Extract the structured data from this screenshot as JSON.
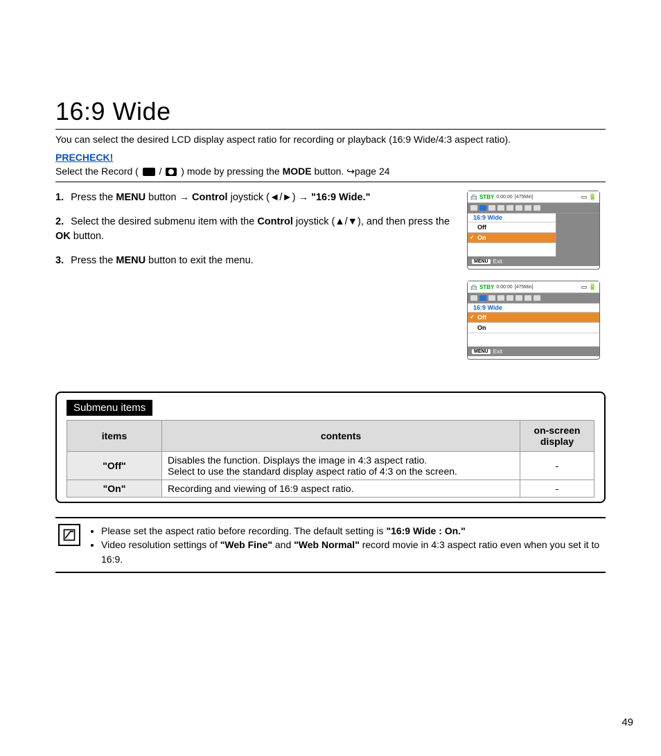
{
  "title": "16:9 Wide",
  "intro": "You can select the desired LCD display aspect ratio for recording or playback (16:9 Wide/4:3 aspect ratio).",
  "precheck": {
    "label": "PRECHECK!",
    "text_before": "Select the Record (",
    "sep": " / ",
    "text_after_icons": ") mode by pressing the ",
    "mode": "MODE",
    "text_after": " button. ",
    "page_ref": "page 24"
  },
  "steps": [
    {
      "num": "1.",
      "parts": [
        "Press the ",
        "MENU",
        " button → ",
        "Control",
        " joystick (◄/►) → ",
        "\"16:9 Wide.\""
      ]
    },
    {
      "num": "2.",
      "parts": [
        "Select the desired submenu item with the ",
        "Control",
        " joystick (▲/▼), and then press the ",
        "OK",
        " button."
      ]
    },
    {
      "num": "3.",
      "parts": [
        "Press the ",
        "MENU",
        " button to exit the menu."
      ]
    }
  ],
  "osd": {
    "stby": "STBY",
    "time": "0:00:00",
    "min": "[475Min]",
    "menu_title": "16:9 Wide",
    "off": "Off",
    "on": "On",
    "menu": "MENU",
    "exit": "Exit"
  },
  "submenu": {
    "label": "Submenu items",
    "headers": [
      "items",
      "contents",
      "on-screen display"
    ],
    "rows": [
      {
        "item": "\"Off\"",
        "content": "Disables the function. Displays the image in 4:3 aspect ratio.\nSelect to use the standard display aspect ratio of 4:3 on the screen.",
        "osd": "-"
      },
      {
        "item": "\"On\"",
        "content": "Recording and viewing of 16:9 aspect ratio.",
        "osd": "-"
      }
    ]
  },
  "notes": {
    "bullets": [
      {
        "pre": "Please set the aspect ratio before recording. The default setting is ",
        "b": "\"16:9 Wide : On.\"",
        "post": ""
      },
      {
        "pre": "Video resolution settings of ",
        "b": "\"Web Fine\"",
        "mid": " and ",
        "b2": "\"Web Normal\"",
        "post": " record movie in 4:3 aspect ratio even when you set it to 16:9."
      }
    ]
  },
  "page_number": "49"
}
